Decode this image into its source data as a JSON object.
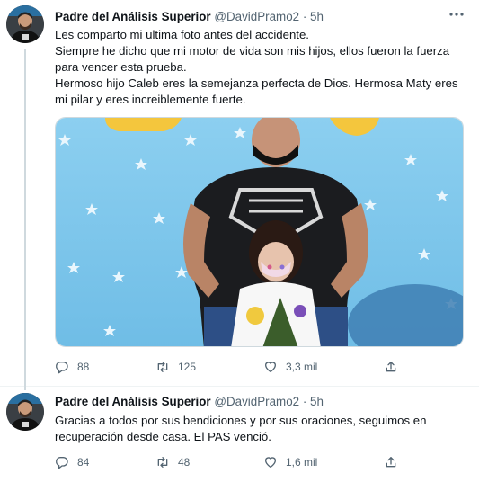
{
  "tweets": [
    {
      "author": {
        "name": "Padre del Análisis Superior",
        "handle": "@DavidPramo2",
        "separator": "·",
        "time": "5h"
      },
      "text_lines": [
        "Les comparto mi ultima foto antes del accidente.",
        "Siempre he dicho que mi motor de vida son mis hijos, ellos fueron la fuerza",
        "para vencer esta prueba.",
        "Hermoso hijo Caleb eres la semejanza perfecta de Dios. Hermosa Maty eres",
        "mi pilar y eres increiblemente fuerte."
      ],
      "stats": {
        "replies": "88",
        "retweets": "125",
        "likes": "3,3 mil"
      }
    },
    {
      "author": {
        "name": "Padre del Análisis Superior",
        "handle": "@DavidPramo2",
        "separator": "·",
        "time": "5h"
      },
      "text_lines": [
        "Gracias a todos por sus bendiciones y por sus oraciones, seguimos en",
        "recuperación desde casa. El PAS venció."
      ],
      "stats": {
        "replies": "84",
        "retweets": "48",
        "likes": "1,6 mil"
      }
    }
  ],
  "icons": {
    "reply": "reply-icon",
    "retweet": "retweet-icon",
    "like": "heart-icon",
    "share": "share-icon",
    "more": "more-icon"
  },
  "colors": {
    "text": "#0f1419",
    "secondary": "#536471",
    "border": "#eff3f4",
    "photo_sky": "#7ec5ec"
  }
}
